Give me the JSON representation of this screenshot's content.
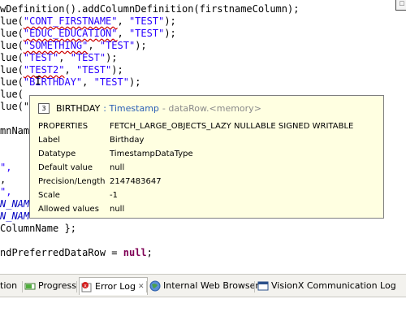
{
  "editor": {
    "lines": [
      {
        "parts": [
          {
            "t": "wDefinition().addColumnDefinition(firstnameColumn);",
            "c": "plain"
          }
        ]
      },
      {
        "parts": [
          {
            "t": "lue(",
            "c": "plain"
          },
          {
            "t": "\"CONT_FIRSTNAME\"",
            "c": "str squiggle"
          },
          {
            "t": ", ",
            "c": "plain"
          },
          {
            "t": "\"TEST\"",
            "c": "str"
          },
          {
            "t": ");",
            "c": "plain"
          }
        ]
      },
      {
        "parts": [
          {
            "t": "lue(",
            "c": "plain"
          },
          {
            "t": "\"EDUC_EDUCATION\"",
            "c": "str squiggle"
          },
          {
            "t": ", ",
            "c": "plain"
          },
          {
            "t": "\"TEST\"",
            "c": "str"
          },
          {
            "t": ");",
            "c": "plain"
          }
        ]
      },
      {
        "parts": [
          {
            "t": "lue(",
            "c": "plain"
          },
          {
            "t": "\"SOMETHING\"",
            "c": "str squiggle"
          },
          {
            "t": ", ",
            "c": "plain"
          },
          {
            "t": "\"TEST\"",
            "c": "str"
          },
          {
            "t": ");",
            "c": "plain"
          }
        ]
      },
      {
        "parts": [
          {
            "t": "lue(",
            "c": "plain"
          },
          {
            "t": "\"TEST\"",
            "c": "str"
          },
          {
            "t": ", ",
            "c": "plain"
          },
          {
            "t": "\"TEST\"",
            "c": "str"
          },
          {
            "t": ");",
            "c": "plain"
          }
        ]
      },
      {
        "parts": [
          {
            "t": "lue(",
            "c": "plain"
          },
          {
            "t": "\"TEST2\"",
            "c": "str squiggle"
          },
          {
            "t": ", ",
            "c": "plain"
          },
          {
            "t": "\"TEST\"",
            "c": "str"
          },
          {
            "t": ");",
            "c": "plain"
          }
        ]
      },
      {
        "parts": [
          {
            "t": "lue(",
            "c": "plain"
          },
          {
            "t": "\"BIRTHDAY\"",
            "c": "str"
          },
          {
            "t": ", ",
            "c": "plain"
          },
          {
            "t": "\"TEST\"",
            "c": "str"
          },
          {
            "t": ");",
            "c": "plain"
          }
        ]
      },
      {
        "parts": [
          {
            "t": "lue(",
            "c": "plain"
          }
        ]
      },
      {
        "parts": [
          {
            "t": "lue(\"",
            "c": "plain"
          }
        ]
      },
      {
        "parts": []
      },
      {
        "parts": [
          {
            "t": "mnNam",
            "c": "plain"
          }
        ]
      },
      {
        "parts": []
      },
      {
        "parts": []
      },
      {
        "parts": [
          {
            "t": "\",",
            "c": "str"
          }
        ]
      },
      {
        "parts": [
          {
            "t": ",",
            "c": "plain"
          }
        ]
      },
      {
        "parts": [
          {
            "t": "\",",
            "c": "str"
          }
        ]
      },
      {
        "parts": [
          {
            "t": "N_NAM",
            "c": "italic"
          }
        ]
      },
      {
        "parts": [
          {
            "t": "N_NAM",
            "c": "italic"
          }
        ]
      },
      {
        "parts": [
          {
            "t": "Column",
            "c": "plain"
          },
          {
            "t": "Name };",
            "c": "plain"
          }
        ]
      },
      {
        "parts": []
      },
      {
        "parts": [
          {
            "t": "ndPreferredDataRow",
            "c": "plain"
          },
          {
            "t": " = ",
            "c": "plain"
          },
          {
            "t": "null",
            "c": "kw"
          },
          {
            "t": ";",
            "c": "plain"
          }
        ]
      }
    ]
  },
  "tooltip": {
    "name": "BIRTHDAY",
    "type": ": Timestamp",
    "source": "- dataRow.<memory>",
    "icon_text": "3",
    "rows": [
      {
        "k": "PROPERTIES",
        "v": "FETCH_LARGE_OBJECTS_LAZY  NULLABLE  SIGNED  WRITABLE"
      },
      {
        "k": "Label",
        "v": "Birthday"
      },
      {
        "k": "Datatype",
        "v": "TimestampDataType"
      },
      {
        "k": "Default value",
        "v": "null"
      },
      {
        "k": "Precision/Length",
        "v": "2147483647"
      },
      {
        "k": "Scale",
        "v": "-1"
      },
      {
        "k": "Allowed values",
        "v": "null"
      }
    ]
  },
  "tabs": {
    "items": [
      {
        "label": "tion",
        "icon": "",
        "active": false
      },
      {
        "label": "Progress",
        "icon": "progress-icon",
        "active": false
      },
      {
        "label": "Error Log",
        "icon": "error-log-icon",
        "active": true
      },
      {
        "label": "Internal Web Browser",
        "icon": "globe-icon",
        "active": false
      },
      {
        "label": "VisionX Communication Log",
        "icon": "window-icon",
        "active": false
      }
    ],
    "close_glyph": "✕"
  },
  "colors": {
    "string": "#2a00ff",
    "keyword": "#7f0055",
    "tooltip_bg": "#ffffe1",
    "type_link": "#2b5fb5"
  }
}
